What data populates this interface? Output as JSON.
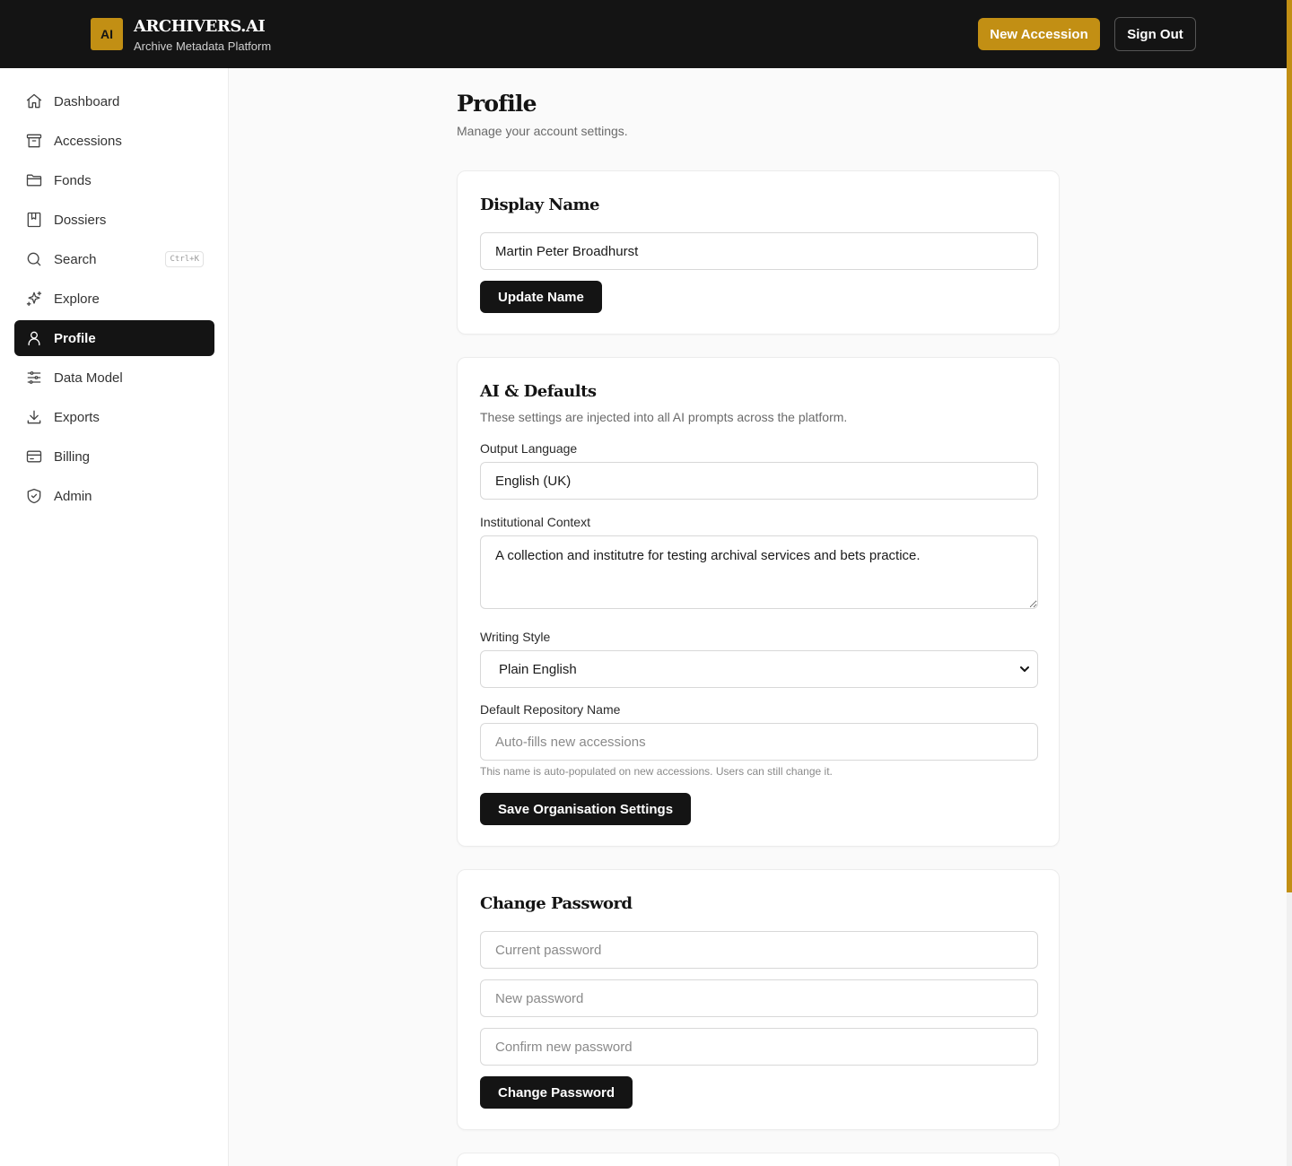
{
  "header": {
    "logo_text": "AI",
    "brand": "ARCHIVERS.AI",
    "tagline": "Archive Metadata Platform",
    "new_accession": "New Accession",
    "sign_out": "Sign Out",
    "accent_color": "#c28f14"
  },
  "sidebar": {
    "items": [
      {
        "label": "Dashboard",
        "icon": "home-icon"
      },
      {
        "label": "Accessions",
        "icon": "archive-box-icon"
      },
      {
        "label": "Fonds",
        "icon": "folder-icon"
      },
      {
        "label": "Dossiers",
        "icon": "book-icon"
      },
      {
        "label": "Search",
        "icon": "search-icon",
        "shortcut": "Ctrl+K"
      },
      {
        "label": "Explore",
        "icon": "sparkle-icon"
      },
      {
        "label": "Profile",
        "icon": "user-icon",
        "active": true
      },
      {
        "label": "Data Model",
        "icon": "sliders-icon"
      },
      {
        "label": "Exports",
        "icon": "download-icon"
      },
      {
        "label": "Billing",
        "icon": "credit-card-icon"
      },
      {
        "label": "Admin",
        "icon": "shield-check-icon"
      }
    ]
  },
  "page": {
    "title": "Profile",
    "subtitle": "Manage your account settings."
  },
  "display_name": {
    "title": "Display Name",
    "value": "Martin Peter Broadhurst",
    "button": "Update Name"
  },
  "ai_defaults": {
    "title": "AI & Defaults",
    "description": "These settings are injected into all AI prompts across the platform.",
    "output_language_label": "Output Language",
    "output_language_value": "English (UK)",
    "institutional_context_label": "Institutional Context",
    "institutional_context_value": "A collection and institutre for testing archival services and bets practice.",
    "writing_style_label": "Writing Style",
    "writing_style_value": "Plain English",
    "repository_label": "Default Repository Name",
    "repository_placeholder": "Auto-fills new accessions",
    "repository_hint": "This name is auto-populated on new accessions. Users can still change it.",
    "button": "Save Organisation Settings"
  },
  "change_password": {
    "title": "Change Password",
    "current_placeholder": "Current password",
    "new_placeholder": "New password",
    "confirm_placeholder": "Confirm new password",
    "button": "Change Password"
  }
}
